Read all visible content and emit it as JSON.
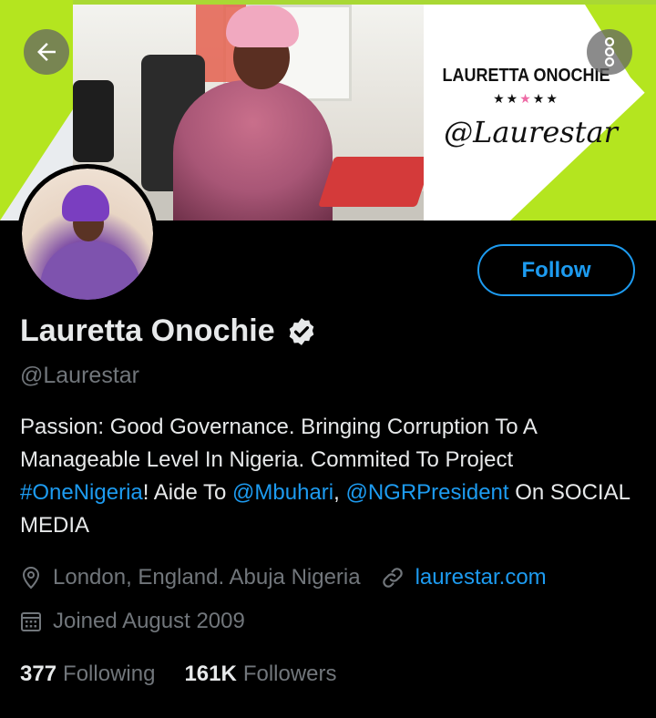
{
  "banner": {
    "name": "LAURETTA ONOCHIE",
    "stars_dark": "★★",
    "stars_pink": "★",
    "stars_dark2": "★★",
    "handle": "@Laurestar"
  },
  "nav": {
    "back_icon": "arrow-left-icon",
    "more_icon": "more-vertical-icon"
  },
  "profile": {
    "display_name": "Lauretta Onochie",
    "verified": true,
    "handle": "@Laurestar",
    "follow_label": "Follow",
    "bio": {
      "part1": "Passion: Good Governance. Bringing Corruption To A Manageable Level In Nigeria. Commited To Project ",
      "hashtag": "#OneNigeria",
      "part2": "! Aide To ",
      "mention1": "@Mbuhari",
      "part3": ", ",
      "mention2": "@NGRPresident",
      "part4": " On SOCIAL MEDIA"
    },
    "location": "London, England. Abuja Nigeria",
    "website": "laurestar.com",
    "joined": "Joined August 2009",
    "following_count": "377",
    "following_label": "Following",
    "followers_count": "161K",
    "followers_label": "Followers"
  },
  "colors": {
    "accent": "#1d9bf0",
    "muted": "#71767b",
    "text": "#e7e9ea",
    "banner_green": "#b4e51f"
  }
}
